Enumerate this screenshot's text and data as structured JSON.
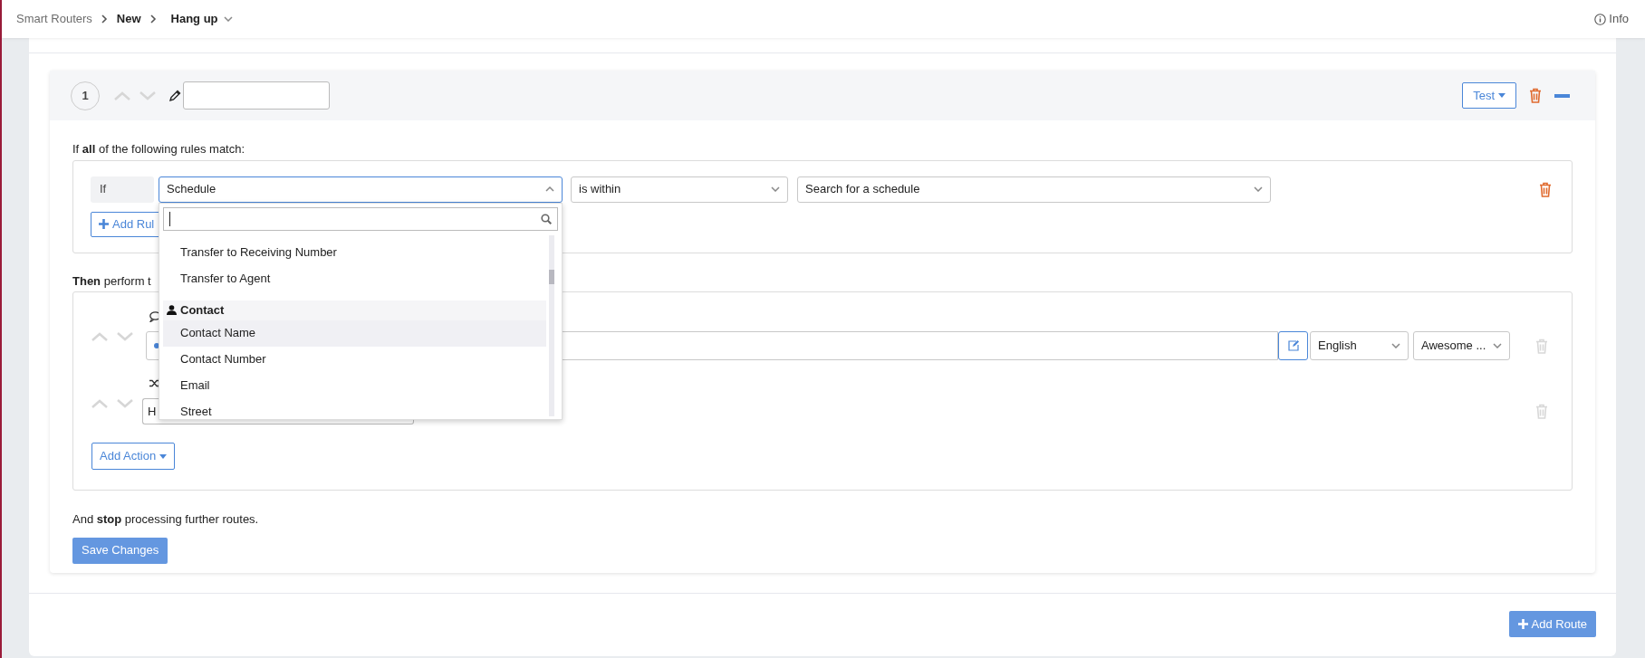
{
  "breadcrumb": {
    "items": [
      "Smart Routers",
      "New"
    ],
    "current": "Hang up"
  },
  "info_link": "Info",
  "route": {
    "number": "1",
    "test_button": "Test",
    "conditions_intro": "If **all** of the following rules match:",
    "rules": [
      {
        "prefix": "If",
        "field": "Schedule",
        "operator": "is within",
        "value_placeholder": "Search for a schedule",
        "expanded": true
      }
    ],
    "add_rule_button": "Add Rul",
    "field_dropdown": {
      "items": [
        {
          "kind": "option",
          "label": "Transfer to Receiving Number",
          "selected": false
        },
        {
          "kind": "option",
          "label": "Transfer to Agent",
          "selected": false
        },
        {
          "kind": "group",
          "label": "Contact"
        },
        {
          "kind": "option",
          "label": "Contact Name",
          "selected": true
        },
        {
          "kind": "option",
          "label": "Contact Number",
          "selected": false
        },
        {
          "kind": "option",
          "label": "Email",
          "selected": false
        },
        {
          "kind": "option",
          "label": "Street",
          "selected": false
        }
      ]
    },
    "actions_intro": "**Then** perform t",
    "actions": [
      {
        "kind": "say",
        "language": "English",
        "voice": "Awesome ..."
      },
      {
        "kind": "route",
        "value": "H"
      }
    ],
    "add_action_button": "Add Action",
    "stop_text": "And **stop** processing further routes.",
    "save_button": "Save Changes"
  },
  "add_route_button": "Add Route"
}
